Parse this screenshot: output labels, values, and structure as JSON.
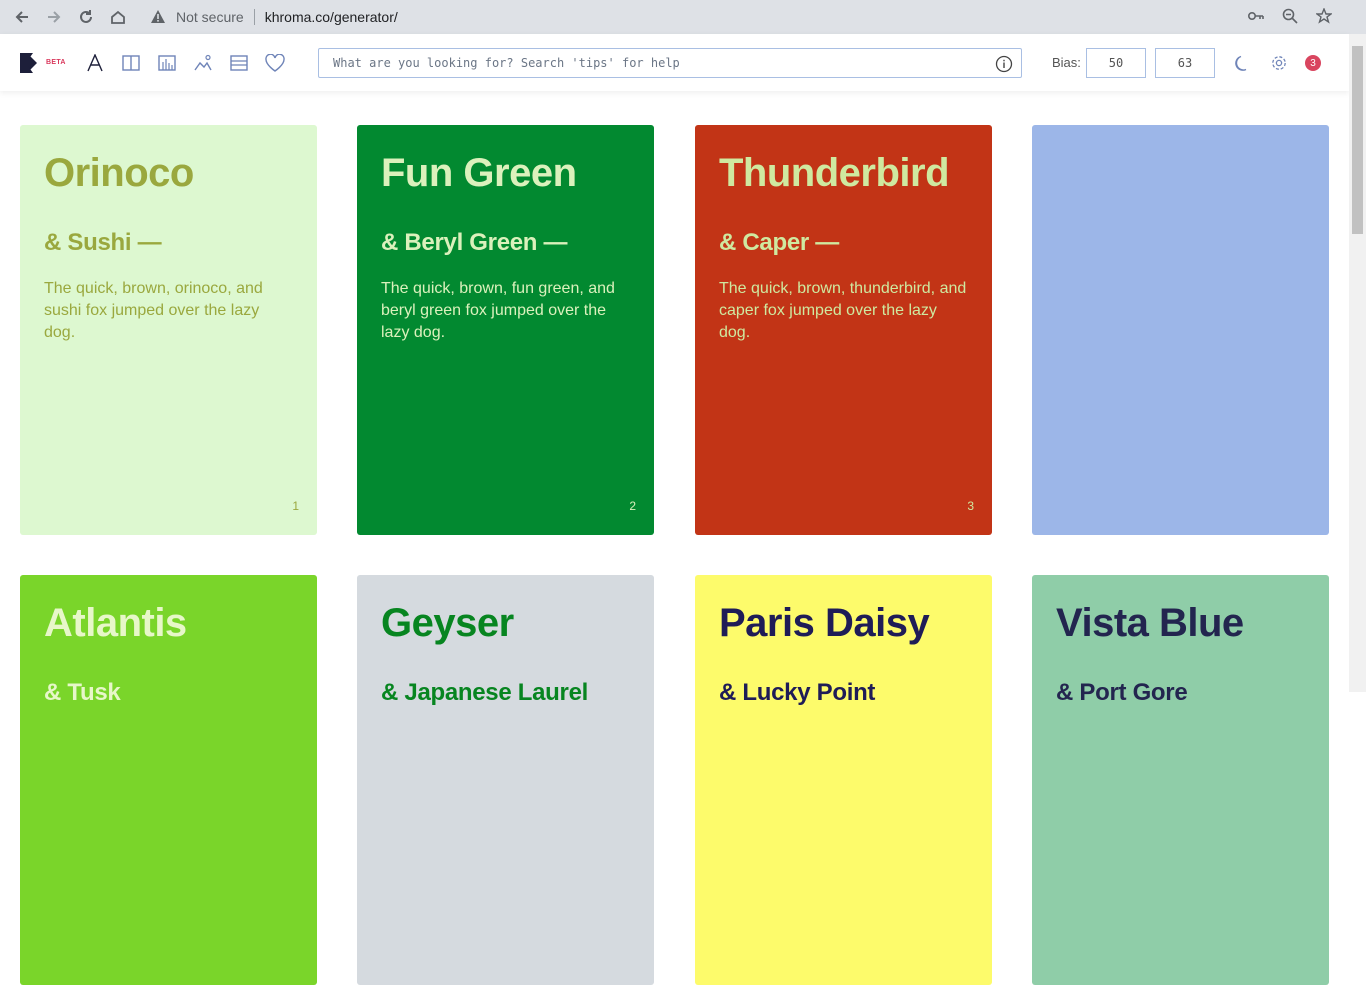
{
  "browser": {
    "security": "Not secure",
    "url": "khroma.co/generator/"
  },
  "app": {
    "beta": "BETA",
    "search_placeholder": "What are you looking for? Search 'tips' for help",
    "bias_label": "Bias:",
    "bias_values": [
      "50",
      "63"
    ],
    "notification_count": "3"
  },
  "cards": [
    {
      "title": "Orinoco",
      "subtitle": "& Sushi —",
      "body": "The quick, brown, orinoco, and sushi fox jumped over the lazy dog.",
      "num": "1",
      "bg": "#ddf8d0",
      "fg": "#9aa83e"
    },
    {
      "title": "Fun Green",
      "subtitle": "& Beryl Green —",
      "body": "The quick, brown, fun green, and beryl green fox jumped over the lazy dog.",
      "num": "2",
      "bg": "#028930",
      "fg": "#dbf1bc"
    },
    {
      "title": "Thunderbird",
      "subtitle": "& Caper —",
      "body": "The quick, brown, thunderbird, and caper fox jumped over the lazy dog.",
      "num": "3",
      "bg": "#c23416",
      "fg": "#cfe9a0"
    },
    {
      "title": "",
      "subtitle": "",
      "body": "",
      "num": "",
      "bg": "#9cb6e8",
      "fg": "#9cb6e8"
    },
    {
      "title": "Atlantis",
      "subtitle": "& Tusk",
      "body": "",
      "num": "",
      "bg": "#7ad52a",
      "fg": "#e7f7c9"
    },
    {
      "title": "Geyser",
      "subtitle": "& Japanese Laurel",
      "body": "",
      "num": "",
      "bg": "#d5dadf",
      "fg": "#078520"
    },
    {
      "title": "Paris Daisy",
      "subtitle": "& Lucky Point",
      "body": "",
      "num": "",
      "bg": "#fdfb6b",
      "fg": "#1f1c57"
    },
    {
      "title": "Vista Blue",
      "subtitle": "& Port Gore",
      "body": "",
      "num": "",
      "bg": "#8fcda8",
      "fg": "#23254f"
    }
  ]
}
